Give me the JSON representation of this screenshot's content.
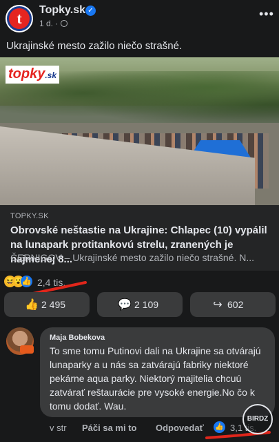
{
  "post": {
    "page_name": "Topky.sk",
    "avatar_letter": "t",
    "time": "1 d. ·",
    "text": "Ukrajinské mesto zažilo niečo strašné."
  },
  "media": {
    "logo_text": "topky",
    "logo_suffix": ".sk"
  },
  "link": {
    "source": "TOPKY.SK",
    "title": "Obrovské neštastie na Ukrajine: Chlapec (10) vypálil na lunapark protitankovú strelu, zranených je najmenej 8...",
    "description": "ČERNIGOV – Ukrajinské mesto zažilo niečo strašné. N..."
  },
  "reactions": {
    "count": "2,4 tis.",
    "emojis": [
      "laugh-emoji",
      "wow-emoji",
      "like-emoji"
    ]
  },
  "actions": [
    {
      "icon": "👍",
      "label": "2 495"
    },
    {
      "icon": "💬",
      "label": "2 109"
    },
    {
      "icon": "↪",
      "label": "602"
    }
  ],
  "comment": {
    "author": "Maja Bobekova",
    "text": "To sme tomu Putinovi dali na Ukrajine sa otvárajú lunaparky a u nás sa zatvárajú fabriky  niektoré pekárne aqua parky. Niektorý majitelia chcuú zatvárať reštaurácie pre vysoké energie.No čo k tomu dodať. Wau.",
    "time": "v str",
    "like_label": "Páči sa mi to",
    "reply_label": "Odpovedať",
    "like_count": "3,1 tis."
  },
  "watermark": "BIRDZ",
  "colors": {
    "background": "#18191a",
    "card": "#242526",
    "bubble": "#3a3b3c",
    "accent": "#1877f2",
    "brand_red": "#e52521",
    "annotation_red": "#e0261b"
  }
}
